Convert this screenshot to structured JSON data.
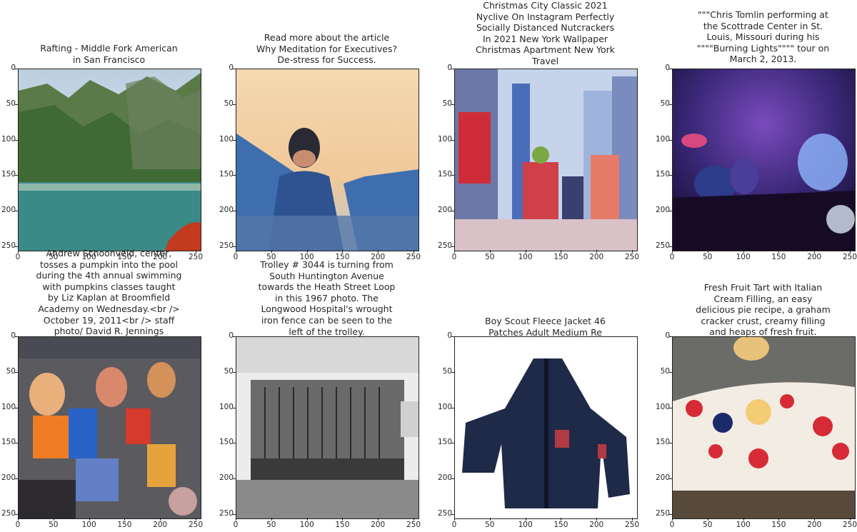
{
  "panels": [
    {
      "title": "Rafting - Middle Fork American\nin San Francisco",
      "scene": "river-canyon"
    },
    {
      "title": "Read more about the article\nWhy Meditation for Executives?\nDe-stress for Success.",
      "scene": "meditation-figure"
    },
    {
      "title": "Christmas City Classic 2021\nNyclive On Instagram Perfectly\nSocially Distanced Nutcrackers\nIn 2021 New York Wallpaper\nChristmas Apartment New York\nTravel",
      "scene": "city-street"
    },
    {
      "title": "\"\"\"Chris Tomlin performing at\nthe Scottrade Center in St.\nLouis, Missouri during his\n\"\"\"\"Burning Lights\"\"\"\" tour on\nMarch 2, 2013.",
      "scene": "concert"
    },
    {
      "title": "Andrew Schoonveld, center,\ntosses a pumpkin into the pool\nduring the 4th annual swimming\nwith pumpkins classes taught\nby Liz Kaplan at Broomfield\nAcademy on Wednesday.<br />\nOctober 19, 2011<br /> staff\nphoto/ David R. Jennings",
      "scene": "pool-crowd"
    },
    {
      "title": "Trolley # 3044 is turning from\nSouth Huntington Avenue\ntowards the Heath Street Loop\nin this 1967 photo. The\nLongwood Hospital's wrought\niron fence can be seen to the\nleft of the trolley.",
      "scene": "trolley"
    },
    {
      "title": "Boy Scout Fleece Jacket 46\nPatches Adult Medium Re",
      "scene": "jacket"
    },
    {
      "title": "Fresh Fruit Tart with Italian\nCream Filling, an easy\ndelicious pie recipe, a graham\ncracker crust, creamy filling\nand heaps of fresh fruit.",
      "scene": "fruit-tart"
    }
  ],
  "axis": {
    "xticks": [
      "0",
      "50",
      "100",
      "150",
      "200",
      "250"
    ],
    "yticks": [
      "0",
      "50",
      "100",
      "150",
      "200",
      "250"
    ]
  }
}
